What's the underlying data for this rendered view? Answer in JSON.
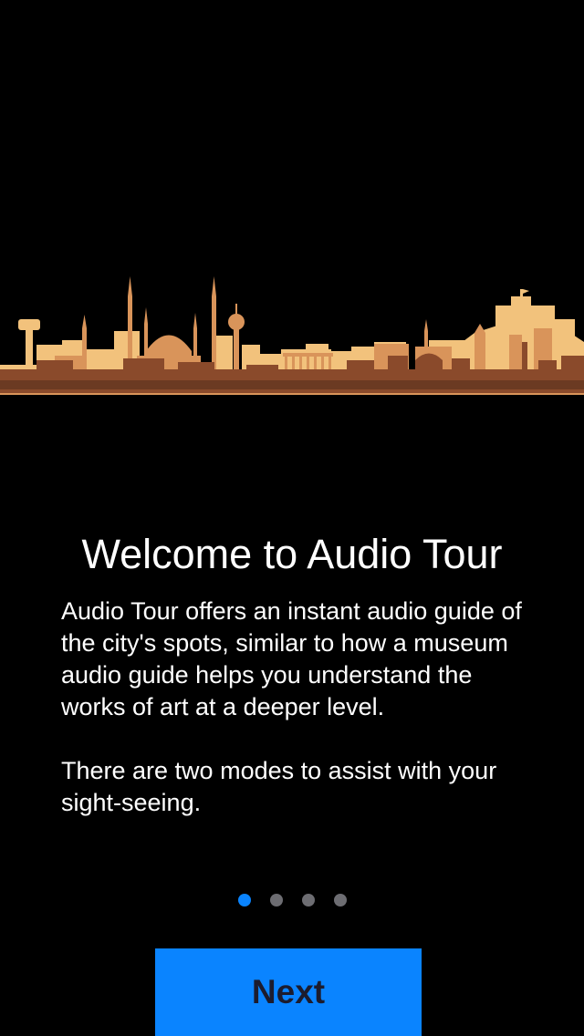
{
  "hero": {
    "illustration": "city-skyline-illustration",
    "colors": {
      "light": "#f2c27c",
      "mid": "#d9945a",
      "dark": "#8a4a2b",
      "ground": "#6b3a22"
    }
  },
  "onboarding": {
    "title": "Welcome to Audio Tour",
    "paragraphs": [
      "Audio Tour offers an instant audio guide of the city's spots, similar to how a museum audio guide helps you understand the works of art at a deeper level.",
      "There are two modes to assist with your sight-seeing."
    ],
    "page_indicator": {
      "total": 4,
      "current": 1
    },
    "next_label": "Next"
  },
  "colors": {
    "background": "#000000",
    "accent": "#0a84ff",
    "inactive_dot": "#6d6d72",
    "button_text": "#1c1c2e"
  }
}
